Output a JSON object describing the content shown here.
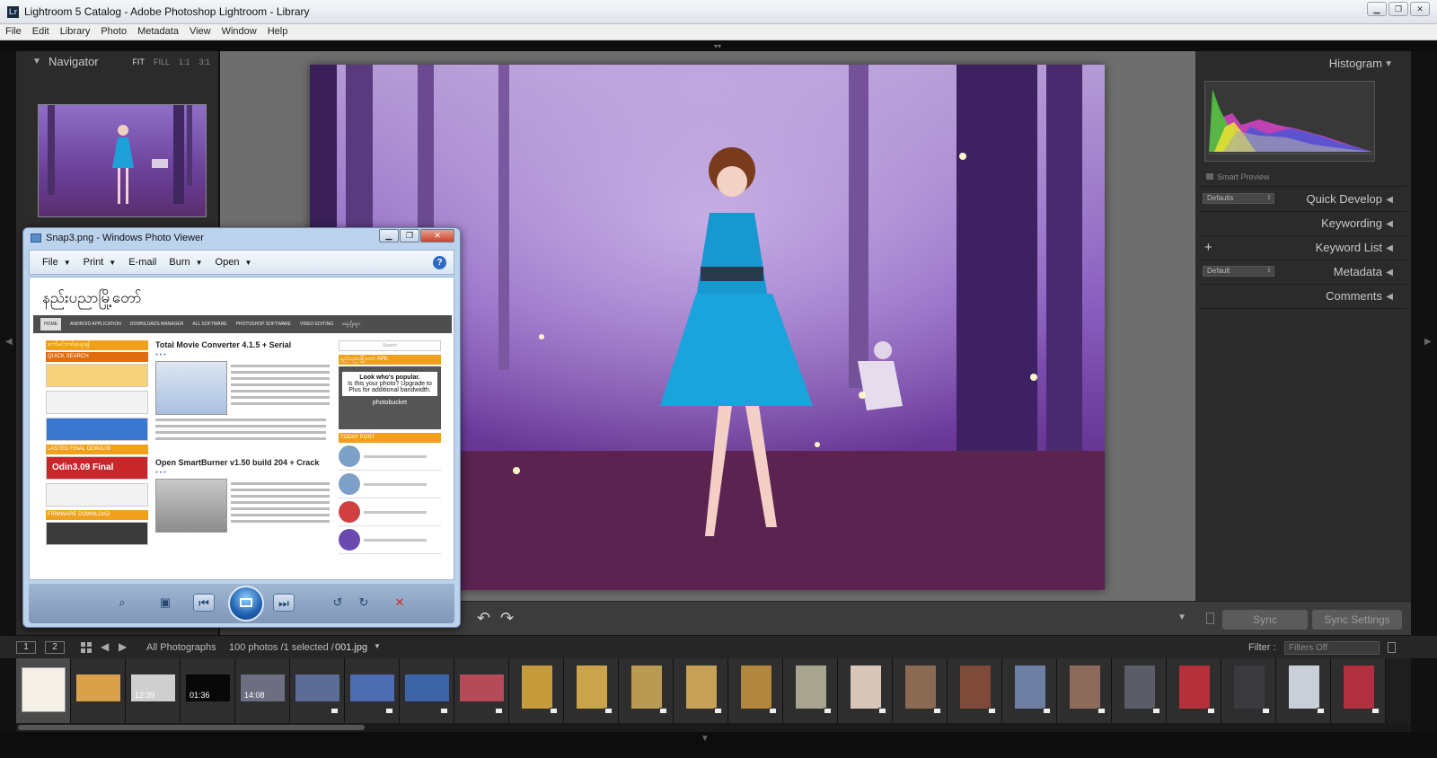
{
  "window": {
    "title": "Lightroom 5 Catalog - Adobe Photoshop Lightroom - Library",
    "app_icon_letters": "Lr",
    "controls": {
      "minimize": "▁",
      "maximize": "❐",
      "close": "✕"
    }
  },
  "menu": [
    "File",
    "Edit",
    "Library",
    "Photo",
    "Metadata",
    "View",
    "Window",
    "Help"
  ],
  "navigator": {
    "title": "Navigator",
    "zoom_options": [
      "FIT",
      "FILL",
      "1:1",
      "3:1"
    ],
    "active_zoom": "FIT"
  },
  "right_panel": {
    "histogram_title": "Histogram",
    "smart_preview": "Smart Preview",
    "quick_develop": "Quick Develop",
    "quick_develop_preset": "Defaults",
    "keywording": "Keywording",
    "keyword_list": "Keyword List",
    "metadata": "Metadata",
    "metadata_preset": "Default",
    "comments": "Comments",
    "sync_label": "Sync",
    "sync_settings_label": "Sync Settings"
  },
  "filmstrip": {
    "page1": "1",
    "page2": "2",
    "source": "All Photographs",
    "count": "100 photos /1 selected /",
    "selected_file": "001.jpg",
    "filter_label": "Filter :",
    "filter_value": "Filters Off",
    "thumbs": [
      {
        "kind": "doc",
        "color": "#f4f0e6"
      },
      {
        "kind": "land",
        "color": "#d9a24a"
      },
      {
        "kind": "land",
        "color": "#cfcfcf",
        "duration": "12:39"
      },
      {
        "kind": "land",
        "color": "#080808",
        "duration": "01:36"
      },
      {
        "kind": "land",
        "color": "#6d6f80",
        "duration": "14:08"
      },
      {
        "kind": "land",
        "color": "#5b6d95"
      },
      {
        "kind": "land",
        "color": "#4d6cb2"
      },
      {
        "kind": "land",
        "color": "#3d64a6"
      },
      {
        "kind": "land",
        "color": "#b54a58"
      },
      {
        "kind": "port",
        "color": "#c59b3b"
      },
      {
        "kind": "port",
        "color": "#c9a44b"
      },
      {
        "kind": "port",
        "color": "#b89a52"
      },
      {
        "kind": "port",
        "color": "#c6a157"
      },
      {
        "kind": "port",
        "color": "#b3863e"
      },
      {
        "kind": "port",
        "color": "#a7a58f"
      },
      {
        "kind": "port",
        "color": "#d8c7b8"
      },
      {
        "kind": "port",
        "color": "#8a6a52"
      },
      {
        "kind": "port",
        "color": "#7f4a39"
      },
      {
        "kind": "port",
        "color": "#6e7fa3"
      },
      {
        "kind": "port",
        "color": "#8c6b5c"
      },
      {
        "kind": "port",
        "color": "#5a5c66"
      },
      {
        "kind": "port",
        "color": "#b5303b"
      },
      {
        "kind": "port",
        "color": "#3a3a3f"
      },
      {
        "kind": "port",
        "color": "#c9cfd8"
      },
      {
        "kind": "port",
        "color": "#b03040"
      }
    ]
  },
  "photo_viewer": {
    "title": "Snap3.png - Windows Photo Viewer",
    "menu": [
      "File",
      "Print",
      "E-mail",
      "Burn",
      "Open"
    ],
    "menu_dropdowns": [
      "File",
      "Print",
      "Burn",
      "Open"
    ],
    "help": "?",
    "webpage": {
      "site_title": "နည်းပညာမြို့တော်",
      "nav": [
        "HOME",
        "ANDROID APPLICATION",
        "DOWNLOADS MANAGER",
        "ALL SOFTWARE",
        "PHOTOSHOP SOFTWARE",
        "VIDEO EDITING",
        "ဆွေမျိုးများ"
      ],
      "post1_title": "Total Movie Converter 4.1.5 + Serial",
      "post2_title": "Open SmartBurner v1.50 build 204 + Crack",
      "left_bars": [
        "ကော်မင်းတစ်ခုရေးရန်",
        "QUICK SEARCH",
        "LASTED FINAL ODIN3.09",
        "FIRMWARE DOWNLOAD"
      ],
      "odin_label": "Odin3.09 Final",
      "ad_title": "Look who's popular.",
      "ad_body": "Is this your photo? Upgrade to Plus for additional bandwidth.",
      "ad_brand": "photobucket",
      "today_post": "TODAY POST",
      "right_bar": "နည်းပညာမြို့တော် APK",
      "search_placeholder": "Search"
    }
  },
  "colors": {
    "lr_panel": "#2b2b2b",
    "lr_center": "#6e6e6e",
    "accent_orange": "#f0a01a"
  }
}
